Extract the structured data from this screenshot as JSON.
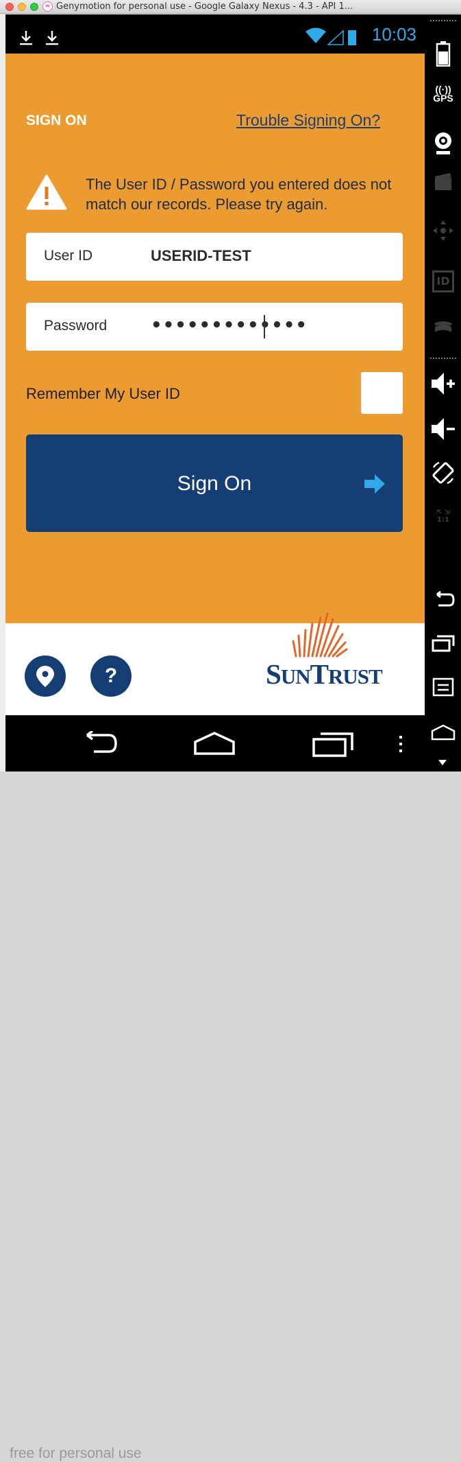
{
  "window": {
    "title": "Genymotion for personal use - Google Galaxy Nexus - 4.3 - API 1..."
  },
  "statusbar": {
    "time": "10:03",
    "accent_color": "#2fa9e7"
  },
  "app": {
    "heading": "SIGN ON",
    "trouble_link": "Trouble Signing On?",
    "error_message": "The User ID / Password you entered does not match our records.  Please try again.",
    "userid": {
      "label": "User ID",
      "value": "USERID-TEST"
    },
    "password": {
      "label": "Password",
      "value": "•••••••••••••"
    },
    "remember_label": "Remember My User ID",
    "remember_checked": false,
    "signon_button": "Sign On",
    "logo": {
      "big1": "S",
      "small1": "UN",
      "big2": "T",
      "small2": "RUST"
    },
    "colors": {
      "orange": "#ec9b31",
      "navy": "#153e75"
    }
  },
  "navbar": {
    "watermark": "free for personal use"
  },
  "sidebar": {
    "gps_label": "GPS",
    "id_label": "ID",
    "ratio_label": "1:1"
  },
  "icons": [
    "download-icon",
    "wifi-icon",
    "signal-icon",
    "battery-icon",
    "warning-icon",
    "arrow-right-icon",
    "location-pin-icon",
    "help-icon",
    "back-icon",
    "home-icon",
    "recents-icon",
    "overflow-menu-icon"
  ]
}
